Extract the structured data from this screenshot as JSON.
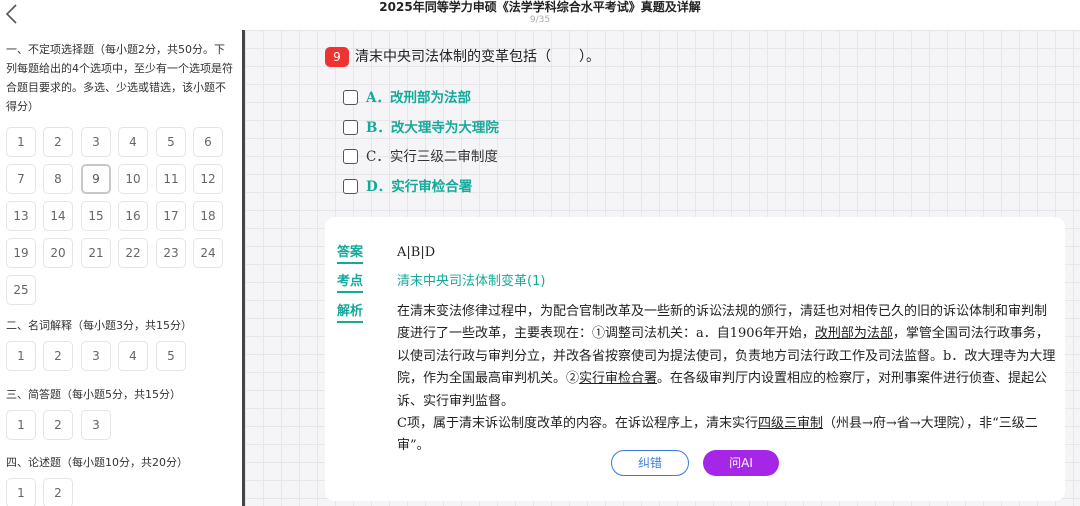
{
  "header": {
    "title": "2025年同等学力申硕《法学学科综合水平考试》真题及详解",
    "progress": "9/35"
  },
  "sidebar": {
    "sections": [
      {
        "title": "一、不定项选择题（每小题2分，共50分。下列每题给出的4个选项中，至少有一个选项是符合题目要求的。多选、少选或错选，该小题不得分）",
        "numbers": [
          "1",
          "2",
          "3",
          "4",
          "5",
          "6",
          "7",
          "8",
          "9",
          "10",
          "11",
          "12",
          "13",
          "14",
          "15",
          "16",
          "17",
          "18",
          "19",
          "20",
          "21",
          "22",
          "23",
          "24",
          "25"
        ]
      },
      {
        "title": "二、名词解释（每小题3分，共15分）",
        "numbers": [
          "1",
          "2",
          "3",
          "4",
          "5"
        ]
      },
      {
        "title": "三、简答题（每小题5分，共15分）",
        "numbers": [
          "1",
          "2",
          "3"
        ]
      },
      {
        "title": "四、论述题（每小题10分，共20分）",
        "numbers": [
          "1",
          "2"
        ]
      }
    ],
    "active_question": "9"
  },
  "question": {
    "number": "9",
    "text": "清末中央司法体制的变革包括（　　）。",
    "options": [
      {
        "label": "A．改刑部为法部",
        "correct": true
      },
      {
        "label": "B．改大理寺为大理院",
        "correct": true
      },
      {
        "label": "C．实行三级二审制度",
        "correct": false
      },
      {
        "label": "D．实行审检合署",
        "correct": true
      }
    ]
  },
  "answer": {
    "answer_label": "答案",
    "answer_value": "A|B|D",
    "knowledge_label": "考点",
    "knowledge_value": "清末中央司法体制变革(1)",
    "analysis_label": "解析",
    "analysis": {
      "p1_a": "在清末变法修律过程中，为配合官制改革及一些新的诉讼法规的颁行，清廷也对相传已久的旧的诉讼体制和审判制度进行了一些改革，主要表现在：①调整司法机关：a．自1906年开始，",
      "p1_u1": "改刑部为法部",
      "p1_b": "，掌管全国司法行政事务，以使司法行政与审判分立，并改各省按察使司为提法使司，负责地方司法行政工作及司法监督。b．改大理寺为大理院，作为全国最高审判机关。②",
      "p1_u2": "实行审检合署",
      "p1_c": "。在各级审判厅内设置相应的检察厅，对刑事案件进行侦查、提起公诉、实行审判监督。",
      "p2_a": "C项，属于清末诉讼制度改革的内容。在诉讼程序上，清末实行",
      "p2_u": "四级三审制",
      "p2_b": "（州县→府→省→大理院），非“三级二审”。"
    },
    "report_button": "纠错",
    "ai_button": "问AI"
  },
  "colors": {
    "accent": "#16a99a",
    "qnum": "#e33333",
    "ai": "#a626e8",
    "report": "#3a7be0"
  }
}
